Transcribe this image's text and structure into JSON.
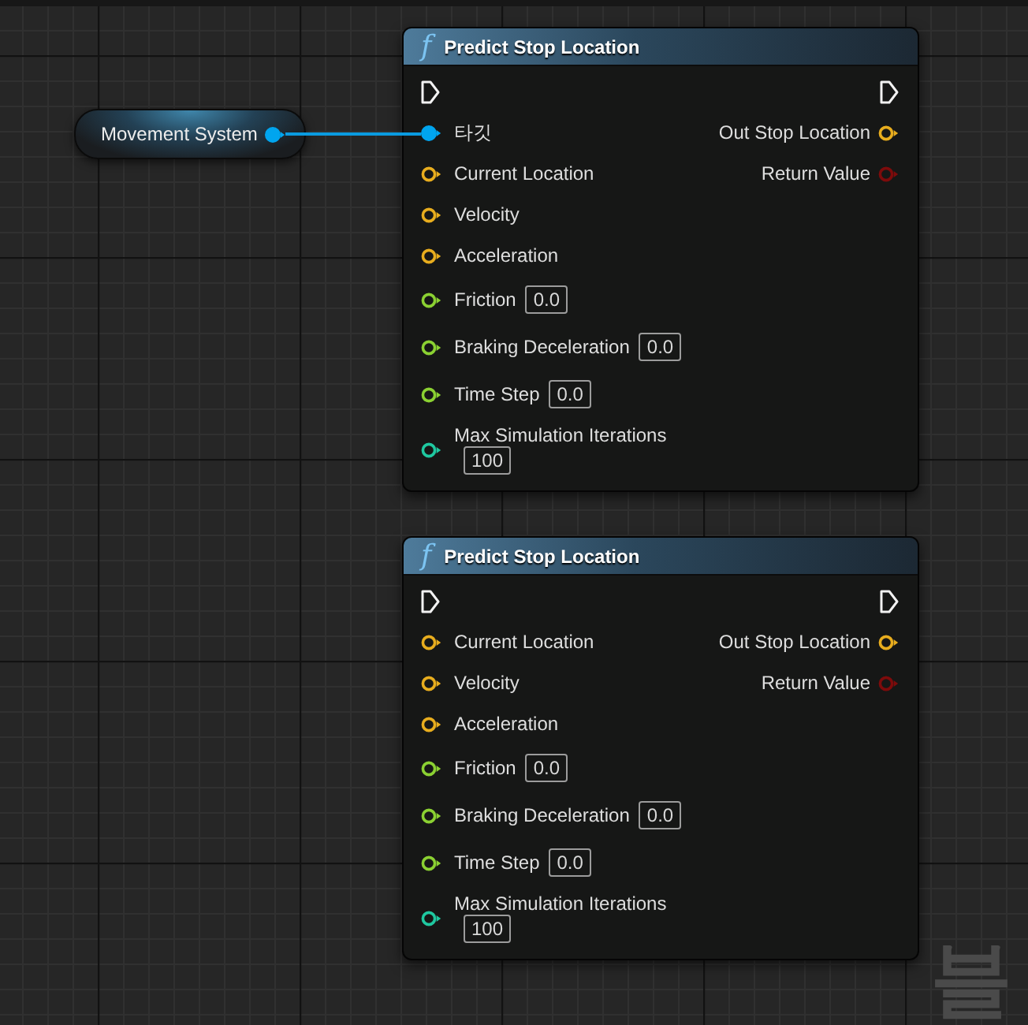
{
  "variable_node": {
    "title": "Movement System",
    "output_pin": {
      "kind": "object",
      "connected": true
    }
  },
  "function_nodes": [
    {
      "icon": "f",
      "title": "Predict Stop Location",
      "inputs": [
        {
          "kind": "object",
          "label": "타깃",
          "connected": true
        },
        {
          "kind": "vector",
          "label": "Current Location",
          "connected": false
        },
        {
          "kind": "vector",
          "label": "Velocity",
          "connected": false
        },
        {
          "kind": "vector",
          "label": "Acceleration",
          "connected": false
        },
        {
          "kind": "float",
          "label": "Friction",
          "value": "0.0",
          "connected": false
        },
        {
          "kind": "float",
          "label": "Braking Deceleration",
          "value": "0.0",
          "connected": false
        },
        {
          "kind": "float",
          "label": "Time Step",
          "value": "0.0",
          "connected": false
        },
        {
          "kind": "integer",
          "label": "Max Simulation Iterations",
          "value": "100",
          "connected": false
        }
      ],
      "outputs": [
        {
          "kind": "vector",
          "label": "Out Stop Location",
          "connected": false
        },
        {
          "kind": "bool",
          "label": "Return Value",
          "connected": false
        }
      ]
    },
    {
      "icon": "f",
      "title": "Predict Stop Location",
      "inputs": [
        {
          "kind": "vector",
          "label": "Current Location",
          "connected": false
        },
        {
          "kind": "vector",
          "label": "Velocity",
          "connected": false
        },
        {
          "kind": "vector",
          "label": "Acceleration",
          "connected": false
        },
        {
          "kind": "float",
          "label": "Friction",
          "value": "0.0",
          "connected": false
        },
        {
          "kind": "float",
          "label": "Braking Deceleration",
          "value": "0.0",
          "connected": false
        },
        {
          "kind": "float",
          "label": "Time Step",
          "value": "0.0",
          "connected": false
        },
        {
          "kind": "integer",
          "label": "Max Simulation Iterations",
          "value": "100",
          "connected": false
        }
      ],
      "outputs": [
        {
          "kind": "vector",
          "label": "Out Stop Location",
          "connected": false
        },
        {
          "kind": "bool",
          "label": "Return Value",
          "connected": false
        }
      ]
    }
  ],
  "corner_label": "블"
}
